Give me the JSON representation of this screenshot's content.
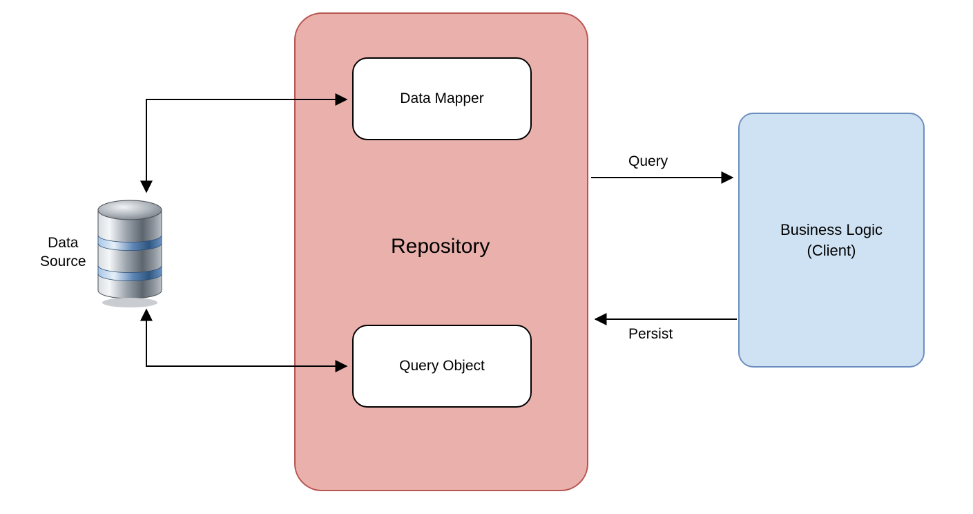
{
  "diagram": {
    "data_source_label": "Data\nSource",
    "repository_title": "Repository",
    "data_mapper_label": "Data Mapper",
    "query_object_label": "Query Object",
    "client_label_line1": "Business Logic",
    "client_label_line2": "(Client)",
    "edge_query": "Query",
    "edge_persist": "Persist"
  },
  "colors": {
    "repo_fill": "#eab1ac",
    "repo_stroke": "#b85450",
    "client_fill": "#cfe2f3",
    "client_stroke": "#6c8ebf",
    "arrow": "#000000"
  }
}
